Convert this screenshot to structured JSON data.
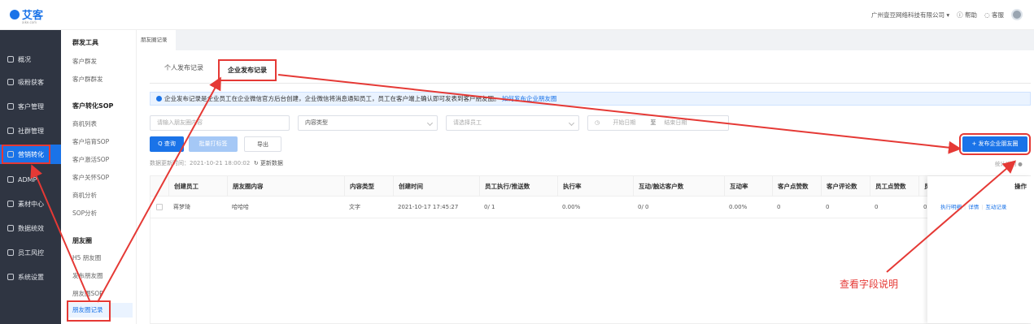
{
  "app": {
    "logo": "艾客",
    "logo_sub": "aike.com"
  },
  "topbar": {
    "company": "广州壹豆网络科技有限公司 ▾",
    "help": "ⓘ 帮助",
    "service": "◌ 客服"
  },
  "sidebar": {
    "items": [
      {
        "label": "概况"
      },
      {
        "label": "吸粉获客"
      },
      {
        "label": "客户管理"
      },
      {
        "label": "社群管理"
      },
      {
        "label": "营销转化"
      },
      {
        "label": "ADMP"
      },
      {
        "label": "素材中心"
      },
      {
        "label": "数据统效"
      },
      {
        "label": "员工风控"
      },
      {
        "label": "系统设置"
      }
    ]
  },
  "submenu": {
    "group1": "群发工具",
    "g1_items": [
      "客户群发",
      "客户群群发"
    ],
    "group2": "客户转化SOP",
    "g2_items": [
      "商机列表",
      "客户培育SOP",
      "客户激活SOP",
      "客户关怀SOP",
      "商机分析",
      "SOP分析"
    ],
    "group3": "朋友圈",
    "g3_items": [
      "H5 朋友圈",
      "发布朋友圈",
      "朋友圈SOP",
      "朋友圈记录"
    ]
  },
  "breadcrumb": {
    "tab": "朋友圈记录"
  },
  "tabs": {
    "personal": "个人发布记录",
    "enterprise": "企业发布记录"
  },
  "notice": {
    "text": "企业发布记录是企业员工在企业微信官方后台创建，企业微信将消息通知员工，员工在客户端上确认即可发表到客户朋友圈。",
    "link": "如何发布企业朋友圈"
  },
  "filters": {
    "search_placeholder": "请输入朋友圈内容",
    "content_type": "内容类型",
    "employee_placeholder": "请选择员工",
    "start_date": "开始日期",
    "date_sep": "至",
    "end_date": "结束日期"
  },
  "buttons": {
    "query": "Q 查询",
    "batch_tag": "批量打标签",
    "export": "导出",
    "publish": "+ 发布企业朋友圈"
  },
  "status": {
    "updated": "数据更新时间：2021-10-21 18:00:02",
    "refresh": "↻ 更新数据"
  },
  "stat_link": "统计说明 ●",
  "table": {
    "columns": [
      "创建员工",
      "朋友圈内容",
      "内容类型",
      "创建时间",
      "员工执行/推送数",
      "执行率",
      "互动/触达客户数",
      "互动率",
      "客户点赞数",
      "客户评论数",
      "员工点赞数",
      "员"
    ],
    "ops_header": "操作",
    "rows": [
      {
        "cells": [
          "蒋梦琦",
          "哈哈哈",
          "文字",
          "2021-10-17 17:45:27",
          "0/ 1",
          "0.00%",
          "0/ 0",
          "0.00%",
          "0",
          "0",
          "0",
          "0"
        ],
        "ops": [
          "执行明细",
          "详情",
          "互动记录"
        ]
      }
    ]
  },
  "annotation": "查看字段说明",
  "colors": {
    "accent": "#1a73e8",
    "sidebar": "#2f3542",
    "annotation_red": "#e53935"
  }
}
